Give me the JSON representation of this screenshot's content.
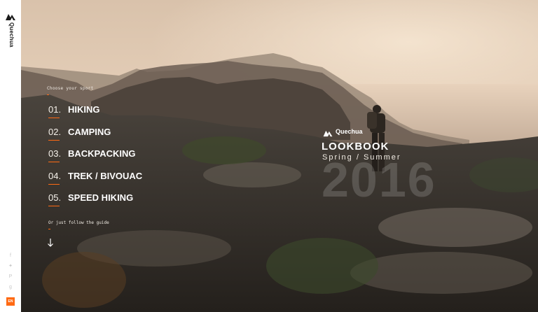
{
  "brand": {
    "name": "Quechua"
  },
  "nav": {
    "title": "Choose your sport",
    "items": [
      {
        "num": "01.",
        "label": "HIKING"
      },
      {
        "num": "02.",
        "label": "CAMPING"
      },
      {
        "num": "03.",
        "label": "BACKPACKING"
      },
      {
        "num": "04.",
        "label": "TREK / BIVOUAC"
      },
      {
        "num": "05.",
        "label": "SPEED HIKING"
      }
    ],
    "guide_text": "Or just follow the guide"
  },
  "lookbook": {
    "brand": "Quechua",
    "title": "LOOKBOOK",
    "subtitle": "Spring / Summer",
    "year": "2016"
  },
  "social": [
    "facebook-icon",
    "twitter-icon",
    "pinterest-icon",
    "googleplus-icon"
  ],
  "language": "EN",
  "colors": {
    "accent": "#ff6a13",
    "sidebar": "#ffffff"
  }
}
